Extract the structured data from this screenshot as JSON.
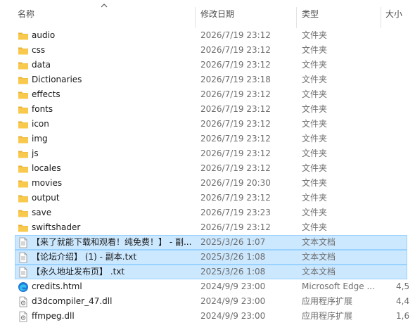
{
  "columns": {
    "name": "名称",
    "date": "修改日期",
    "type": "类型",
    "size": "大小"
  },
  "rows": [
    {
      "name": "audio",
      "date": "2026/7/19 23:12",
      "type": "文件夹",
      "size": "",
      "icon": "folder-icon",
      "selected": false
    },
    {
      "name": "css",
      "date": "2026/7/19 23:12",
      "type": "文件夹",
      "size": "",
      "icon": "folder-icon",
      "selected": false
    },
    {
      "name": "data",
      "date": "2026/7/19 23:12",
      "type": "文件夹",
      "size": "",
      "icon": "folder-icon",
      "selected": false
    },
    {
      "name": "Dictionaries",
      "date": "2026/7/19 23:18",
      "type": "文件夹",
      "size": "",
      "icon": "folder-icon",
      "selected": false
    },
    {
      "name": "effects",
      "date": "2026/7/19 23:12",
      "type": "文件夹",
      "size": "",
      "icon": "folder-icon",
      "selected": false
    },
    {
      "name": "fonts",
      "date": "2026/7/19 23:12",
      "type": "文件夹",
      "size": "",
      "icon": "folder-icon",
      "selected": false
    },
    {
      "name": "icon",
      "date": "2026/7/19 23:12",
      "type": "文件夹",
      "size": "",
      "icon": "folder-icon",
      "selected": false
    },
    {
      "name": "img",
      "date": "2026/7/19 23:12",
      "type": "文件夹",
      "size": "",
      "icon": "folder-icon",
      "selected": false
    },
    {
      "name": "js",
      "date": "2026/7/19 23:12",
      "type": "文件夹",
      "size": "",
      "icon": "folder-icon",
      "selected": false
    },
    {
      "name": "locales",
      "date": "2026/7/19 23:12",
      "type": "文件夹",
      "size": "",
      "icon": "folder-icon",
      "selected": false
    },
    {
      "name": "movies",
      "date": "2026/7/19 20:30",
      "type": "文件夹",
      "size": "",
      "icon": "folder-icon",
      "selected": false
    },
    {
      "name": "output",
      "date": "2026/7/19 23:12",
      "type": "文件夹",
      "size": "",
      "icon": "folder-icon",
      "selected": false
    },
    {
      "name": "save",
      "date": "2026/7/19 23:23",
      "type": "文件夹",
      "size": "",
      "icon": "folder-icon",
      "selected": false
    },
    {
      "name": "swiftshader",
      "date": "2026/7/19 23:12",
      "type": "文件夹",
      "size": "",
      "icon": "folder-icon",
      "selected": false
    },
    {
      "name": "【来了就能下载和观看！纯免费！】 - 副...",
      "date": "2025/3/26 1:07",
      "type": "文本文档",
      "size": "",
      "icon": "text-file-icon",
      "selected": true
    },
    {
      "name": "【论坛介绍】 (1) - 副本.txt",
      "date": "2025/3/26 1:08",
      "type": "文本文档",
      "size": "",
      "icon": "text-file-icon",
      "selected": true
    },
    {
      "name": "【永久地址发布页】 .txt",
      "date": "2025/3/26 1:08",
      "type": "文本文档",
      "size": "",
      "icon": "text-file-icon",
      "selected": true
    },
    {
      "name": "credits.html",
      "date": "2024/9/9 23:00",
      "type": "Microsoft Edge ...",
      "size": "4,5",
      "icon": "edge-html-icon",
      "selected": false
    },
    {
      "name": "d3dcompiler_47.dll",
      "date": "2024/9/9 23:00",
      "type": "应用程序扩展",
      "size": "4,4",
      "icon": "dll-file-icon",
      "selected": false
    },
    {
      "name": "ffmpeg.dll",
      "date": "2024/9/9 23:00",
      "type": "应用程序扩展",
      "size": "1,6",
      "icon": "dll-file-icon",
      "selected": false
    }
  ],
  "colors": {
    "selection_fill": "#cce8ff",
    "selection_border": "#99d1ff",
    "folder": "#f8c94c"
  }
}
